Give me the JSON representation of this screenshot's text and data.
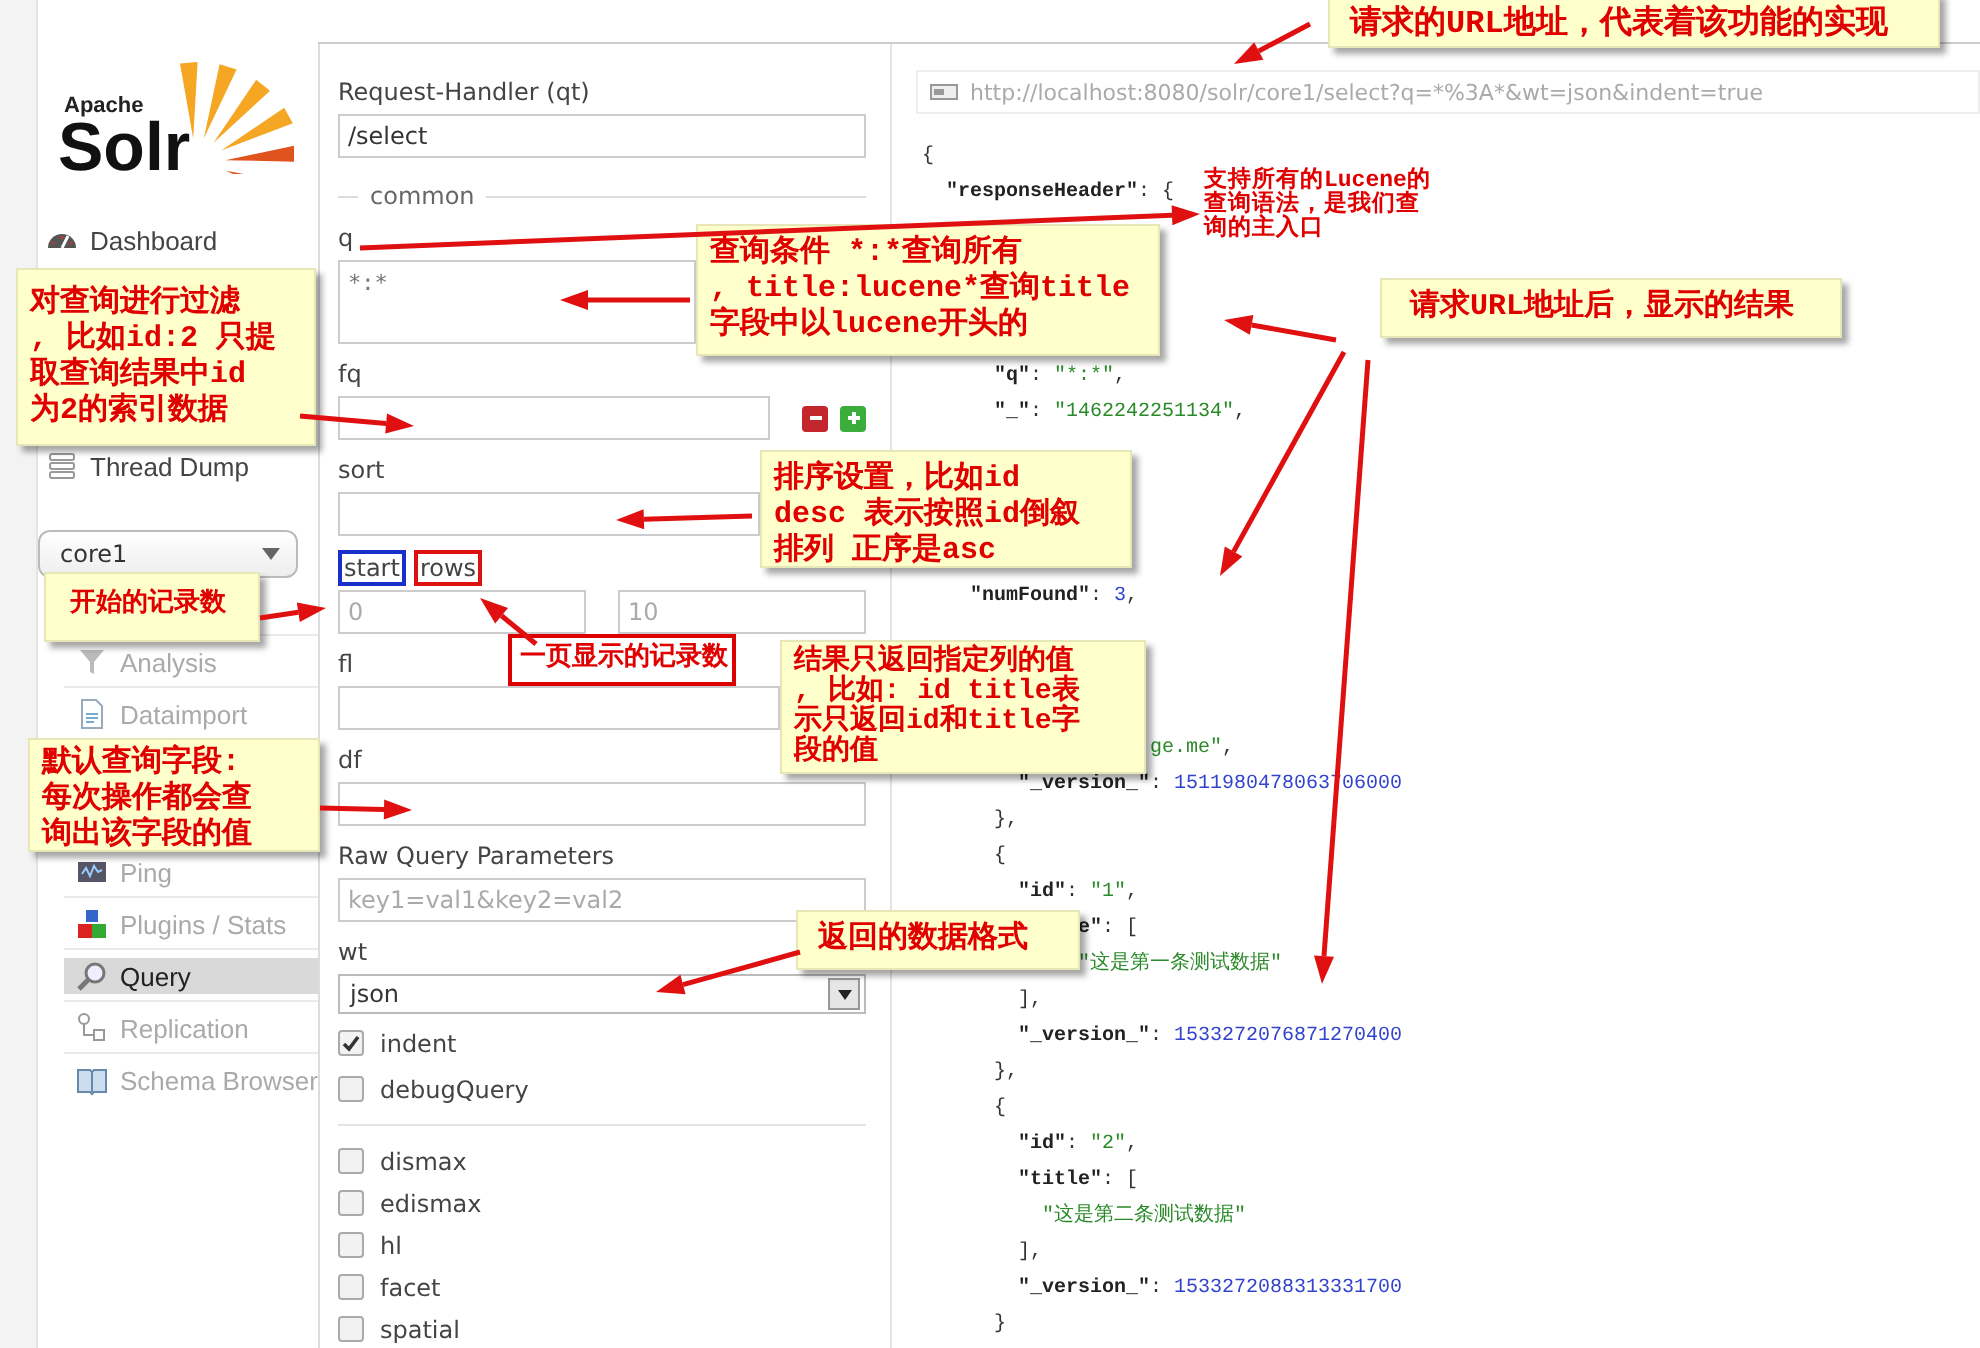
{
  "sidebar": {
    "logo": {
      "small": "Apache",
      "big": "Solr"
    },
    "nav": [
      {
        "label": "Dashboard"
      },
      {
        "label": "Thread Dump"
      }
    ],
    "core_selector": {
      "value": "core1"
    },
    "core_menu": [
      {
        "label": "Analysis",
        "selected": false
      },
      {
        "label": "Dataimport",
        "selected": false
      },
      {
        "label": "Ping",
        "selected": false
      },
      {
        "label": "Plugins / Stats",
        "selected": false
      },
      {
        "label": "Query",
        "selected": true
      },
      {
        "label": "Replication",
        "selected": false
      },
      {
        "label": "Schema Browser",
        "selected": false
      }
    ]
  },
  "form": {
    "handler": {
      "label": "Request-Handler (qt)",
      "value": "/select"
    },
    "section": "common",
    "fields": [
      {
        "kind": "textarea",
        "label": "q",
        "value": "*:*"
      },
      {
        "kind": "multi",
        "label": "fq"
      },
      {
        "kind": "text",
        "label": "sort"
      },
      {
        "kind": "pair",
        "items": [
          {
            "label": "start",
            "color": "#1a2ecc",
            "placeholder": "0"
          },
          {
            "label": "rows",
            "color": "#dd1111",
            "placeholder": "10"
          }
        ]
      },
      {
        "kind": "text",
        "label": "fl"
      },
      {
        "kind": "text",
        "label": "df"
      },
      {
        "kind": "text",
        "label": "Raw Query Parameters",
        "placeholder": "key1=val1&key2=val2"
      },
      {
        "kind": "select",
        "label": "wt",
        "value": "json"
      }
    ],
    "options": [
      {
        "label": "indent",
        "checked": true
      },
      {
        "label": "debugQuery",
        "checked": false
      }
    ],
    "parsers": [
      {
        "label": "dismax",
        "checked": false
      },
      {
        "label": "edismax",
        "checked": false
      },
      {
        "label": "hl",
        "checked": false
      },
      {
        "label": "facet",
        "checked": false
      },
      {
        "label": "spatial",
        "checked": false
      }
    ]
  },
  "results": {
    "url": "http://localhost:8080/solr/core1/select?q=*%3A*&wt=json&indent=true",
    "blocks": [
      [
        [
          {
            "kind": "punct",
            "text": "{"
          }
        ],
        [
          {
            "kind": "key",
            "text": "  \"responseHeader\""
          },
          {
            "kind": "punct",
            "text": ": {"
          }
        ]
      ],
      [
        [
          {
            "kind": "key",
            "text": "      \"q\""
          },
          {
            "kind": "punct",
            "text": ": "
          },
          {
            "kind": "string",
            "text": "\"*:*\""
          },
          {
            "kind": "punct",
            "text": ","
          }
        ],
        [
          {
            "kind": "key",
            "text": "      \"_\""
          },
          {
            "kind": "punct",
            "text": ": "
          },
          {
            "kind": "string",
            "text": "\"1462242251134\""
          },
          {
            "kind": "punct",
            "text": ","
          }
        ]
      ],
      [
        [
          {
            "kind": "key",
            "text": "    \"numFound\""
          },
          {
            "kind": "punct",
            "text": ": "
          },
          {
            "kind": "number",
            "text": "3"
          },
          {
            "kind": "punct",
            "text": ","
          }
        ]
      ],
      [
        [
          {
            "kind": "string",
            "text": "                   ge.me\""
          },
          {
            "kind": "punct",
            "text": ","
          }
        ],
        [
          {
            "kind": "key",
            "text": "        \"_version_\""
          },
          {
            "kind": "punct",
            "text": ": "
          },
          {
            "kind": "number",
            "text": "1511980478063706000"
          }
        ],
        [
          {
            "kind": "punct",
            "text": "      },"
          }
        ],
        [
          {
            "kind": "punct",
            "text": "      {"
          }
        ],
        [
          {
            "kind": "key",
            "text": "        \"id\""
          },
          {
            "kind": "punct",
            "text": ": "
          },
          {
            "kind": "string",
            "text": "\"1\""
          },
          {
            "kind": "punct",
            "text": ","
          }
        ],
        [
          {
            "kind": "key",
            "text": "             e\""
          },
          {
            "kind": "punct",
            "text": ": ["
          }
        ],
        [
          {
            "kind": "string",
            "text": "             \"这是第一条测试数据\""
          }
        ],
        [
          {
            "kind": "punct",
            "text": "        ],"
          }
        ],
        [
          {
            "kind": "key",
            "text": "        \"_version_\""
          },
          {
            "kind": "punct",
            "text": ": "
          },
          {
            "kind": "number",
            "text": "1533272076871270400"
          }
        ],
        [
          {
            "kind": "punct",
            "text": "      },"
          }
        ],
        [
          {
            "kind": "punct",
            "text": "      {"
          }
        ],
        [
          {
            "kind": "key",
            "text": "        \"id\""
          },
          {
            "kind": "punct",
            "text": ": "
          },
          {
            "kind": "string",
            "text": "\"2\""
          },
          {
            "kind": "punct",
            "text": ","
          }
        ],
        [
          {
            "kind": "key",
            "text": "        \"title\""
          },
          {
            "kind": "punct",
            "text": ": ["
          }
        ],
        [
          {
            "kind": "string",
            "text": "          \"这是第二条测试数据\""
          }
        ],
        [
          {
            "kind": "punct",
            "text": "        ],"
          }
        ],
        [
          {
            "kind": "key",
            "text": "        \"_version_\""
          },
          {
            "kind": "punct",
            "text": ": "
          },
          {
            "kind": "number",
            "text": "1533272088313331700"
          }
        ],
        [
          {
            "kind": "punct",
            "text": "      }"
          }
        ]
      ]
    ]
  },
  "annotations": [
    {
      "kind": "callout",
      "lines": [
        "请求的URL地址，代表着该功能的实现"
      ]
    },
    {
      "kind": "note",
      "lines": [
        "支持所有的Lucene的",
        "查询语法，是我们查",
        "询的主入口"
      ]
    },
    {
      "kind": "callout",
      "lines": [
        "查询条件 *:*查询所有",
        ", title:lucene*查询title",
        "字段中以lucene开头的"
      ]
    },
    {
      "kind": "callout",
      "lines": [
        "对查询进行过滤",
        ", 比如id:2 只提",
        "取查询结果中id",
        "为2的索引数据"
      ]
    },
    {
      "kind": "callout",
      "lines": [
        "请求URL地址后，显示的结果"
      ]
    },
    {
      "kind": "callout",
      "lines": [
        "排序设置，比如id",
        "desc 表示按照id倒叙",
        "排列 正序是asc"
      ]
    },
    {
      "kind": "callout",
      "lines": [
        "开始的记录数"
      ]
    },
    {
      "kind": "tag",
      "lines": [
        "一页显示的记录数"
      ]
    },
    {
      "kind": "callout",
      "lines": [
        "结果只返回指定列的值",
        ", 比如: id title表",
        "示只返回id和title字",
        "段的值"
      ]
    },
    {
      "kind": "callout",
      "lines": [
        "默认查询字段:",
        "每次操作都会查",
        "询出该字段的值"
      ]
    },
    {
      "kind": "callout",
      "lines": [
        "返回的数据格式"
      ]
    }
  ]
}
